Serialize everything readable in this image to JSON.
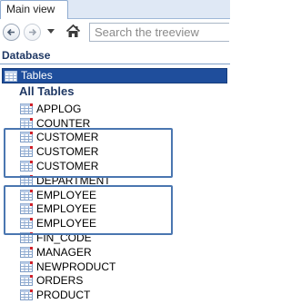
{
  "tabs": {
    "main_view": "Main view"
  },
  "toolbar": {
    "search_placeholder": "Search the treeview"
  },
  "database_label": "Database",
  "tables_header": "Tables",
  "all_tables_label": "All Tables",
  "tables": [
    "APPLOG",
    "COUNTER",
    "CUSTOMER",
    "CUSTOMER",
    "CUSTOMER",
    "DEPARTMENT",
    "EMPLOYEE",
    "EMPLOYEE",
    "EMPLOYEE",
    "FIN_CODE",
    "MANAGER",
    "NEWPRODUCT",
    "ORDERS",
    "PRODUCT"
  ],
  "colors": {
    "accent": "#1f4e9c",
    "highlight_box": "#4a76b0",
    "icon_marker": "#d0202a"
  },
  "icons": {
    "back": "back-arrow-icon",
    "forward": "forward-arrow-icon",
    "home": "home-icon",
    "table": "table-grid-icon"
  }
}
